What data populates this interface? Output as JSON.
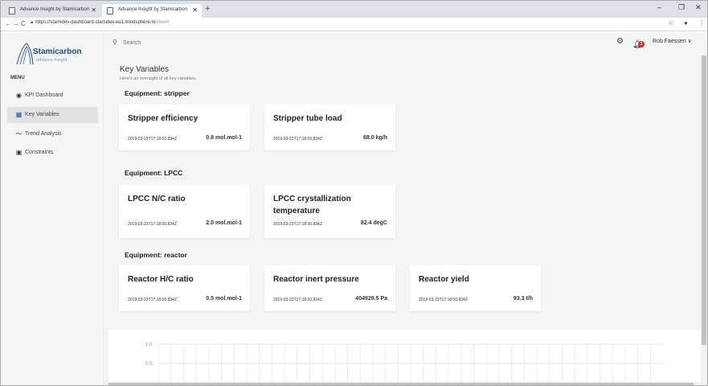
{
  "browser": {
    "tabs": [
      {
        "title": "Advance Insight by Stamicarbon"
      },
      {
        "title": "Advance Insight by Stamicarbon"
      }
    ],
    "new_tab": "+",
    "url_host": "https://stamidev-dashboard-stamidev.eu1.mindsphere.io",
    "url_path": "/view4",
    "window_controls": {
      "minimize": "–",
      "maximize": "❐",
      "close": "✕"
    }
  },
  "logo": {
    "name": "Stamicarbon",
    "tagline": "advance insight"
  },
  "sidebar": {
    "menu_title": "MENU",
    "items": [
      {
        "label": "KPI Dashboard",
        "icon": "target-icon",
        "glyph": "◉",
        "active": false
      },
      {
        "label": "Key Variables",
        "icon": "grid-icon",
        "glyph": "▦",
        "active": true
      },
      {
        "label": "Trend Analysis",
        "icon": "trend-icon",
        "glyph": "〜",
        "active": false
      },
      {
        "label": "Constraints",
        "icon": "calendar-check-icon",
        "glyph": "▣",
        "active": false
      }
    ]
  },
  "header": {
    "search_placeholder": "Search",
    "notification_count": "3",
    "user_name": "Rob Faessen",
    "user_caret": "∨"
  },
  "page": {
    "title": "Key Variables",
    "subtitle": "Here's an oversight of all key variables."
  },
  "sections": [
    {
      "title": "Equipment: stripper",
      "cards": [
        {
          "title": "Stripper efficiency",
          "timestamp": "2019-03-23T17:18:00.834Z",
          "value": "0.8 mol.mol-1"
        },
        {
          "title": "Stripper tube load",
          "timestamp": "2019-03-23T17:18:00.834Z",
          "value": "68.0 kg/h"
        }
      ]
    },
    {
      "title": "Equipment: LPCC",
      "cards": [
        {
          "title": "LPCC N/C ratio",
          "timestamp": "2019-03-23T17:18:00.834Z",
          "value": "2.0 mol.mol-1"
        },
        {
          "title": "LPCC crystallization temperature",
          "timestamp": "2019-03-23T17:18:00.834Z",
          "value": "82.4 degC"
        }
      ]
    },
    {
      "title": "Equipment: reactor",
      "cards": [
        {
          "title": "Reactor H/C ratio",
          "timestamp": "2019-03-23T17:18:00.834Z",
          "value": "0.5 mol.mol-1"
        },
        {
          "title": "Reactor inert pressure",
          "timestamp": "2019-03-23T17:18:00.834Z",
          "value": "404929.5 Pa"
        },
        {
          "title": "Reactor yield",
          "timestamp": "2019-03-23T17:18:00.834Z",
          "value": "93.3 t/h"
        }
      ]
    }
  ],
  "chart": {
    "y_ticks": [
      "1.0",
      "0.5"
    ]
  },
  "colors": {
    "brand": "#1b4f8a",
    "badge": "#d32f2f",
    "active_nav": "#e2e2e2"
  }
}
